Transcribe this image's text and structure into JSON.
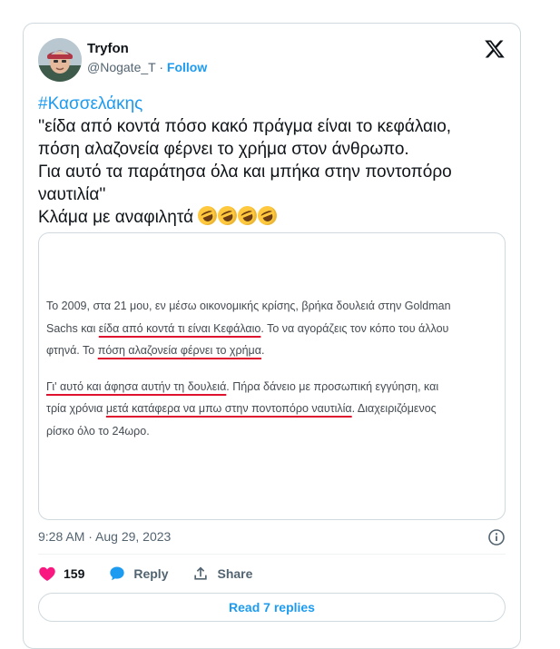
{
  "author": {
    "name": "Tryfon",
    "handle": "@Nogate_T",
    "separator": "·",
    "follow_label": "Follow"
  },
  "tweet": {
    "hashtag": "#Κασσελάκης",
    "lines": [
      "''είδα από κοντά πόσο κακό πράγμα είναι το κεφάλαιο,",
      "πόση αλαζονεία φέρνει το χρήμα στον άνθρωπο.",
      "Για αυτό τα παράτησα όλα και μπήκα στην ποντοπόρο",
      "ναυτιλία''"
    ],
    "last_line": "Κλάμα με αναφιλητά",
    "emoji_name": "rolling-on-the-floor-laughing",
    "emoji_count": 4
  },
  "media": {
    "p1_l1": "Το 2009, στα 21 μου, εν μέσω οικονομικής κρίσης, βρήκα δουλειά στην Goldman",
    "p1_l2a": "Sachs και ",
    "p1_l2b": "είδα από κοντά τι είναι Κεφάλαιο",
    "p1_l2c": ". Το να αγοράζεις τον κόπο του άλλου",
    "p1_l3a": "φτηνά. Το ",
    "p1_l3b": "πόση αλαζονεία φέρνει το χρήμα",
    "p1_l3c": ".",
    "p2_l1a": "Γι' αυτό και άφησα αυτήν τη δουλειά",
    "p2_l1b": ". Πήρα δάνειο με προσωπική εγγύηση, και",
    "p2_l2a": "τρία χρόνια ",
    "p2_l2b": "μετά κατάφερα να μπω στην ποντοπόρο ναυτιλία",
    "p2_l2c": ". Διαχειριζόμενος",
    "p2_l3": "ρίσκο όλο το 24ωρο."
  },
  "meta": {
    "timestamp": "9:28 AM · Aug 29, 2023"
  },
  "actions": {
    "like_count": "159",
    "reply_label": "Reply",
    "share_label": "Share"
  },
  "replies_button": "Read 7 replies",
  "colors": {
    "accent": "#1d9bf0",
    "like": "#f91880",
    "underline": "#e0132f",
    "border": "#cfd9de",
    "muted": "#536471"
  }
}
